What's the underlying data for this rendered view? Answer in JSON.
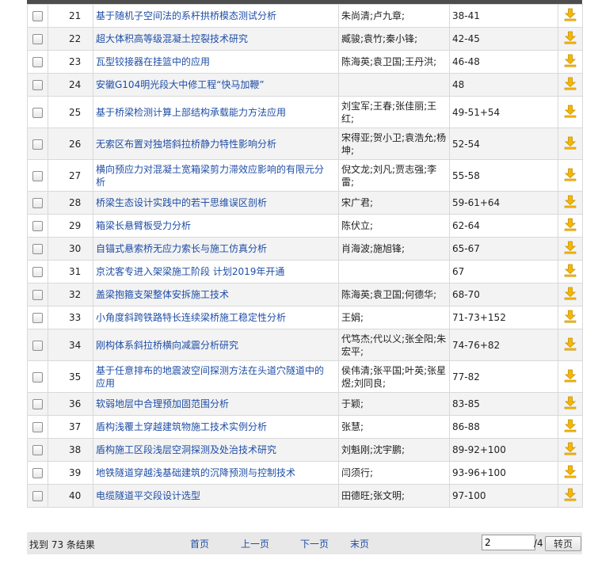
{
  "rows": [
    {
      "num": "21",
      "title": "基于随机子空间法的系杆拱桥模态测试分析",
      "authors": "朱尚清;卢九章;",
      "pages": "38-41"
    },
    {
      "num": "22",
      "title": "超大体积高等级混凝土控裂技术研究",
      "authors": "臧骏;袁竹;秦小锋;",
      "pages": "42-45"
    },
    {
      "num": "23",
      "title": "瓦型铰接器在挂篮中的应用",
      "authors": "陈海英;袁卫国;王丹洪;",
      "pages": "46-48"
    },
    {
      "num": "24",
      "title": "安徽G104明光段大中修工程“快马加鞭”",
      "authors": "",
      "pages": "48"
    },
    {
      "num": "25",
      "title": "基于桥梁检测计算上部结构承载能力方法应用",
      "authors": "刘宝军;王春;张佳丽;王红;",
      "pages": "49-51+54"
    },
    {
      "num": "26",
      "title": "无索区布置对独塔斜拉桥静力特性影响分析",
      "authors": "宋得亚;贺小卫;袁浩允;杨坤;",
      "pages": "52-54"
    },
    {
      "num": "27",
      "title": "横向预应力对混凝土宽箱梁剪力滞效应影响的有限元分析",
      "authors": "倪文龙;刘凡;贾志强;李雷;",
      "pages": "55-58"
    },
    {
      "num": "28",
      "title": "桥梁生态设计实践中的若干思维误区剖析",
      "authors": "宋广君;",
      "pages": "59-61+64"
    },
    {
      "num": "29",
      "title": "箱梁长悬臂板受力分析",
      "authors": "陈伏立;",
      "pages": "62-64"
    },
    {
      "num": "30",
      "title": "自锚式悬索桥无应力索长与施工仿真分析",
      "authors": "肖海波;施旭锋;",
      "pages": "65-67"
    },
    {
      "num": "31",
      "title": "京沈客专进入架梁施工阶段  计划2019年开通",
      "authors": "",
      "pages": "67"
    },
    {
      "num": "32",
      "title": "盖梁抱箍支架整体安拆施工技术",
      "authors": "陈海英;袁卫国;何德华;",
      "pages": "68-70"
    },
    {
      "num": "33",
      "title": "小角度斜跨铁路特长连续梁桥施工稳定性分析",
      "authors": "王娟;",
      "pages": "71-73+152"
    },
    {
      "num": "34",
      "title": "刚构体系斜拉桥横向减震分析研究",
      "authors": "代笃杰;代以义;张全阳;朱宏平;",
      "pages": "74-76+82"
    },
    {
      "num": "35",
      "title": "基于任意排布的地震波空间探测方法在头道穴隧道中的应用",
      "authors": "侯伟清;张平国;叶英;张星煜;刘同良;",
      "pages": "77-82"
    },
    {
      "num": "36",
      "title": "软弱地层中合理预加固范围分析",
      "authors": "于颖;",
      "pages": "83-85"
    },
    {
      "num": "37",
      "title": "盾构浅覆土穿越建筑物施工技术实例分析",
      "authors": "张慧;",
      "pages": "86-88"
    },
    {
      "num": "38",
      "title": "盾构施工区段浅层空洞探测及处治技术研究",
      "authors": "刘魁刚;沈宇鹏;",
      "pages": "89-92+100"
    },
    {
      "num": "39",
      "title": "地铁隧道穿越浅基础建筑的沉降预测与控制技术",
      "authors": "闫须行;",
      "pages": "93-96+100"
    },
    {
      "num": "40",
      "title": "电缆隧道平交段设计选型",
      "authors": "田德旺;张文明;",
      "pages": "97-100"
    }
  ],
  "pager": {
    "total_label": "找到 73 条结果",
    "first": "首页",
    "prev": "上一页",
    "next": "下一页",
    "last": "末页",
    "current_page": "2",
    "pages_suffix": "/4",
    "go_label": "转页"
  },
  "colors": {
    "link": "#1f4ea6",
    "download_icon": "#f5b800",
    "row_alt": "#f3f3f3",
    "header_bar": "#4d4d4d"
  }
}
